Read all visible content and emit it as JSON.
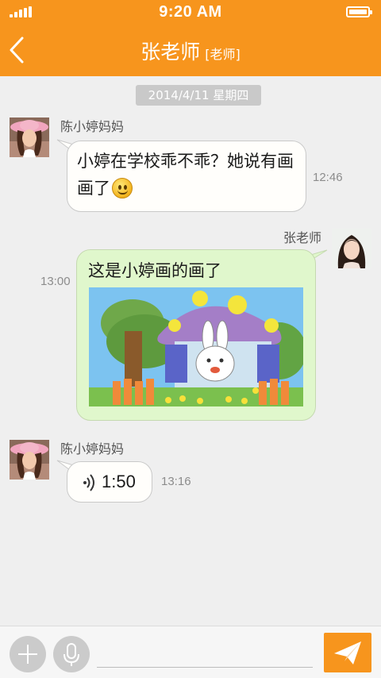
{
  "status_bar": {
    "time": "9:20 AM"
  },
  "header": {
    "title": "张老师",
    "role_tag": "[老师]"
  },
  "date_divider": "2014/4/11  星期四",
  "messages": [
    {
      "sender": "陈小婷妈妈",
      "side": "left",
      "type": "text",
      "text": "小婷在学校乖不乖？她说有画画了",
      "emoji": "smile-emoji",
      "time": "12:46"
    },
    {
      "sender": "张老师",
      "side": "right",
      "type": "text+image",
      "text": "这是小婷画的画了",
      "image": "children-drawing-rabbit-mushroom-house",
      "time": "13:00"
    },
    {
      "sender": "陈小婷妈妈",
      "side": "left",
      "type": "voice",
      "duration": "1:50",
      "time": "13:16"
    }
  ],
  "input_bar": {
    "placeholder": "",
    "value": ""
  },
  "colors": {
    "accent": "#f7951d",
    "outgoing_bubble": "#e0f7cc",
    "incoming_bubble": "#fffefb",
    "background": "#efefef"
  },
  "icons": [
    "signal-icon",
    "battery-icon",
    "back-arrow-icon",
    "emoji-icon",
    "voice-wave-icon",
    "plus-icon",
    "microphone-icon",
    "send-plane-icon"
  ]
}
